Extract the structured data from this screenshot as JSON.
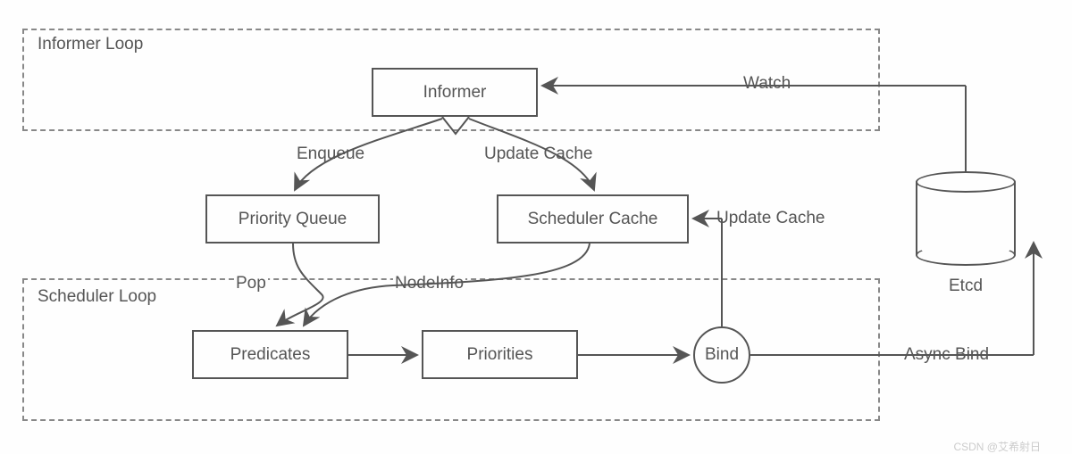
{
  "diagram": {
    "groups": {
      "informer_loop": "Informer Loop",
      "scheduler_loop": "Scheduler Loop"
    },
    "nodes": {
      "informer": "Informer",
      "priority_queue": "Priority Queue",
      "scheduler_cache": "Scheduler Cache",
      "predicates": "Predicates",
      "priorities": "Priorities",
      "bind": "Bind",
      "etcd": "Etcd"
    },
    "edges": {
      "enqueue": "Enqueue",
      "update_cache_1": "Update Cache",
      "update_cache_2": "Update Cache",
      "pop": "Pop",
      "nodeinfo": "NodeInfo",
      "watch": "Watch",
      "async_bind": "Async Bind"
    }
  },
  "watermark": "CSDN @艾希射日"
}
